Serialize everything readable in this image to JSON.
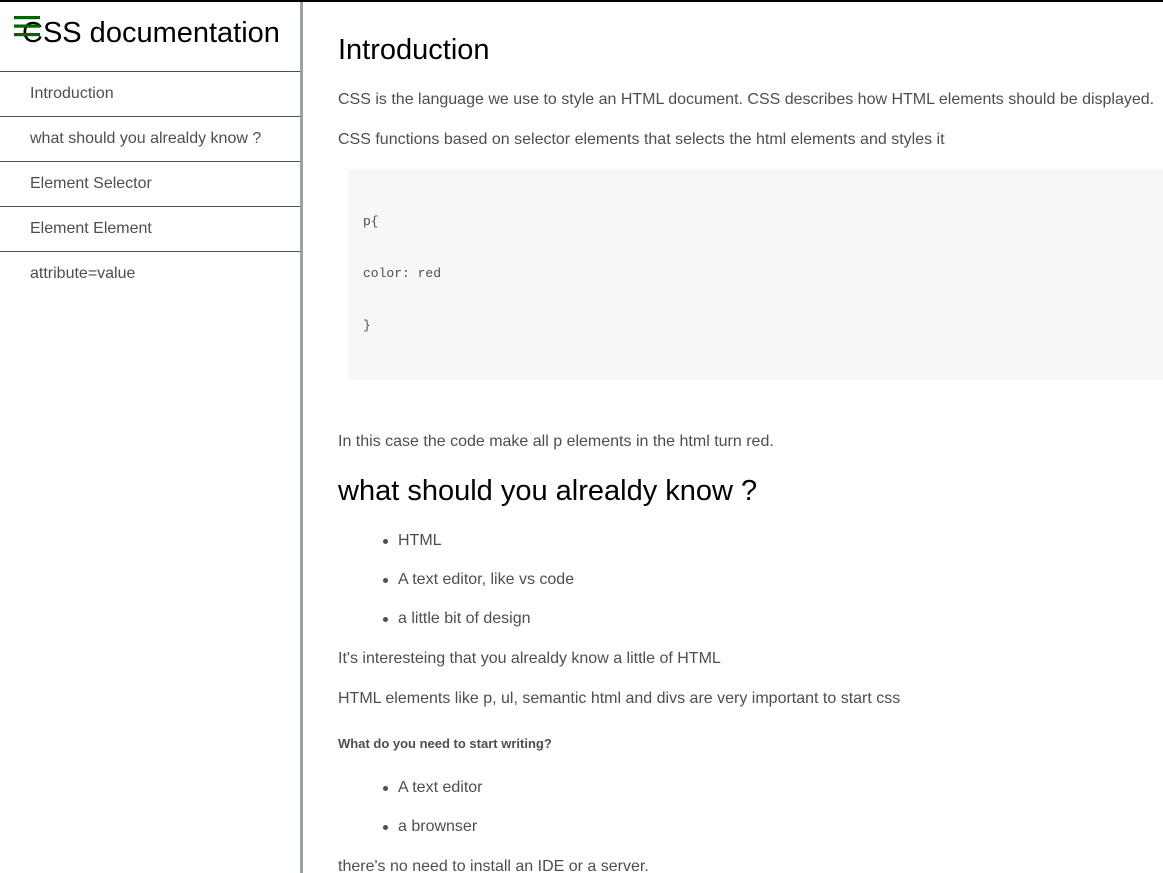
{
  "sidebar": {
    "title": "CSS documentation",
    "menu_icon": "hamburger-menu-icon",
    "menu_icon_color": "#006400",
    "items": [
      {
        "label": "Introduction"
      },
      {
        "label": "what should you alrealdy know ?"
      },
      {
        "label": "Element Selector"
      },
      {
        "label": "Element Element"
      },
      {
        "label": "attribute=value"
      }
    ]
  },
  "main": {
    "intro": {
      "heading": "Introduction",
      "paragraph_1": "CSS is the language we use to style an HTML document. CSS describes how HTML elements should be displayed.",
      "paragraph_2": "CSS functions based on selector elements that selects the html elements and styles it",
      "code": [
        "p{",
        "color: red",
        "}"
      ],
      "paragraph_3": "In this case the code make all p elements in the html turn red."
    },
    "know": {
      "heading": "what should you alrealdy know ?",
      "bullets": [
        "HTML",
        "A text editor, like vs code",
        "a little bit of design"
      ],
      "paragraph_1": "It's interesteing that you alrealdy know a little of HTML",
      "paragraph_2": "HTML elements like p, ul, semantic html and divs are very important to start css",
      "subheading": "What do you need to start writing?",
      "bullets_2": [
        "A text editor",
        "a brownser"
      ],
      "paragraph_3": "there's no need to install an IDE or a server."
    }
  }
}
